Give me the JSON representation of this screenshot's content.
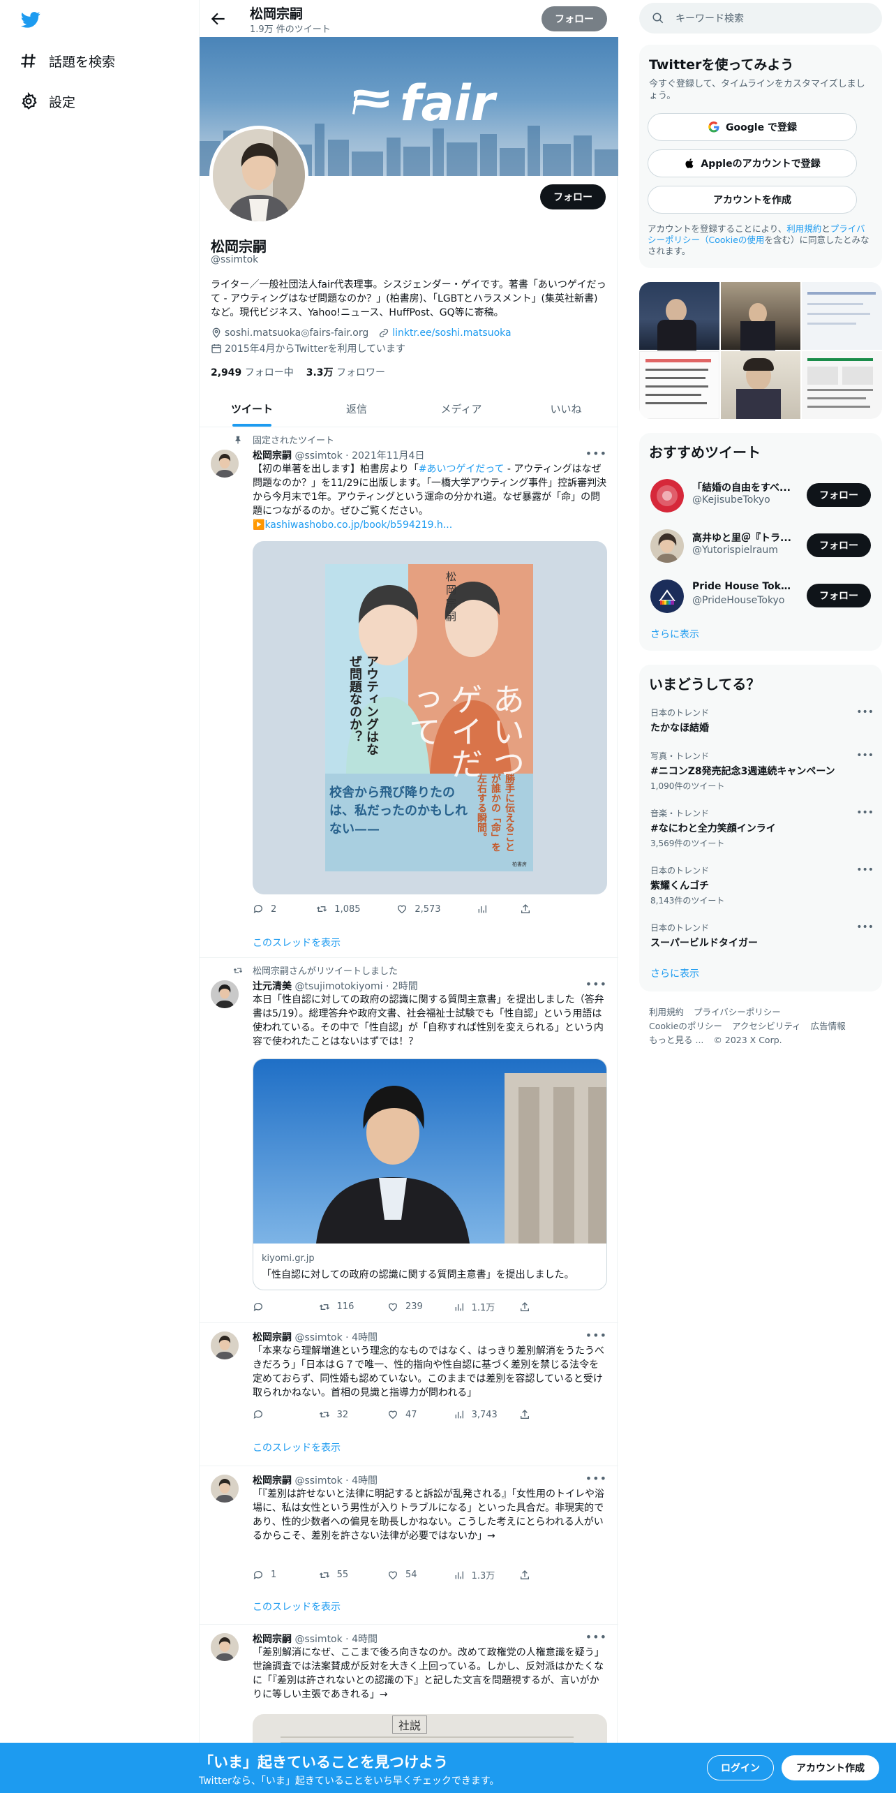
{
  "nav": {
    "items": [
      {
        "label": "話題を検索",
        "icon": "hashtag-icon"
      },
      {
        "label": "設定",
        "icon": "gear-icon"
      }
    ]
  },
  "profile": {
    "header_name": "松岡宗嗣",
    "tweet_count": "1.9万 件のツイート",
    "follow_label": "フォロー",
    "banner_text": "fair",
    "name": "松岡宗嗣",
    "handle": "@ssimtok",
    "bio": "ライター／一般社団法人fair代表理事。シスジェンダー・ゲイです。著書「あいつゲイだって - アウティングはなぜ問題なのか？」(柏書房)、「LGBTとハラスメント」(集英社新書) など。現代ビジネス、Yahoo!ニュース、HuffPost、GQ等に寄稿。",
    "location": "soshi.matsuoka◎fairs-fair.org",
    "website": "linktr.ee/soshi.matsuoka",
    "joined": "2015年4月からTwitterを利用しています",
    "following_count": "2,949",
    "following_label": "フォロー中",
    "followers_count": "3.3万",
    "followers_label": "フォロワー"
  },
  "tabs": [
    "ツイート",
    "返信",
    "メディア",
    "いいね"
  ],
  "tweets": [
    {
      "context": "固定されたツイート",
      "name": "松岡宗嗣",
      "handle": "@ssimtok",
      "time": "2021年11月4日",
      "text_pre": "【初の単著を出します】柏書房より「",
      "text_tag": "#あいつゲイだって",
      "text_post": " - アウティングはなぜ問題なのか？」を11/29に出版します。「一橋大学アウティング事件」控訴審判決から今月末で1年。アウティングという運命の分かれ道。なぜ暴露が「命」の問題につながるのか。ぜひご覧ください。",
      "link": "kashiwashobo.co.jp/book/b594219.h...",
      "book": {
        "author": "松岡宗嗣",
        "title1": "あいつ",
        "title2": "ゲイ",
        "title3": "だって",
        "subtitle": "アウティングはなぜ問題なのか？",
        "side": "勝手に伝えることが誰かの「命」を左右する瞬間。",
        "catch": "校舎から飛び降りたのは、私だったのかもしれない——",
        "publisher": "柏書房"
      },
      "replies": "2",
      "retweets": "1,085",
      "likes": "2,573",
      "thread": "このスレッドを表示"
    },
    {
      "context": "松岡宗嗣さんがリツイートしました",
      "name": "辻元清美",
      "handle": "@tsujimotokiyomi",
      "time": "2時間",
      "text": "本日「性自認に対しての政府の認識に関する質問主意書」を提出しました（答弁書は5/19）。総理答弁や政府文書、社会福祉士試験でも「性自認」という用語は使われている。その中で「性自認」が「自称すれば性別を変えられる」という内容で使われたことはないはずでは！？",
      "card_domain": "kiyomi.gr.jp",
      "card_title": "「性自認に対しての政府の認識に関する質問主意書」を提出しました。",
      "replies": "",
      "retweets": "116",
      "likes": "239",
      "views": "1.1万"
    },
    {
      "name": "松岡宗嗣",
      "handle": "@ssimtok",
      "time": "4時間",
      "text": "「本来なら理解増進という理念的なものではなく、はっきり差別解消をうたうべきだろう」「日本はＧ７で唯一、性的指向や性自認に基づく差別を禁じる法令を定めておらず、同性婚も認めていない。このままでは差別を容認していると受け取られかねない。首相の見識と指導力が問われる」",
      "replies": "",
      "retweets": "32",
      "likes": "47",
      "views": "3,743",
      "thread": "このスレッドを表示"
    },
    {
      "name": "松岡宗嗣",
      "handle": "@ssimtok",
      "time": "4時間",
      "text": "「『差別は許せないと法律に明記すると訴訟が乱発される』「女性用のトイレや浴場に、私は女性という男性が入りトラブルになる」といった具合だ。非現実的であり、性的少数者への偏見を助長しかねない。こうした考えにとらわれる人がいるからこそ、差別を許さない法律が必要ではないか」→",
      "replies": "1",
      "retweets": "55",
      "likes": "54",
      "views": "1.3万",
      "thread": "このスレッドを表示"
    },
    {
      "name": "松岡宗嗣",
      "handle": "@ssimtok",
      "time": "4時間",
      "text": "「差別解消になぜ、ここまで後ろ向きなのか。改めて政権党の人権意識を疑う」世論調査では法案賛成が反対を大きく上回っている。しかし、反対派はかたくなに「『差別は許されないとの認識の下』と記した文言を問題視するが、言いがかりに等しい主張であきれる」→",
      "image_caption": "社説"
    }
  ],
  "right": {
    "search_placeholder": "キーワード検索",
    "signup": {
      "title": "Twitterを使ってみよう",
      "desc": "今すぐ登録して、タイムラインをカスタマイズしましょう。",
      "google": "Google で登録",
      "apple": "Appleのアカウントで登録",
      "create": "アカウントを作成",
      "terms_pre": "アカウントを登録することにより、",
      "terms_link1": "利用規約",
      "terms_mid": "と",
      "terms_link2": "プライバシーポリシー（Cookieの使用",
      "terms_post": "を含む）に同意したとみなされます。"
    },
    "recommend": {
      "title": "おすすめツイート",
      "users": [
        {
          "name": "「結婚の自由をすべ...",
          "handle": "@KejisubeTokyo",
          "follow": "フォロー"
        },
        {
          "name": "高井ゆと里＠『トラ...",
          "handle": "@Yutorispielraum",
          "follow": "フォロー"
        },
        {
          "name": "Pride House Tokyo (...",
          "handle": "@PrideHouseTokyo",
          "follow": "フォロー"
        }
      ],
      "more": "さらに表示"
    },
    "trends": {
      "title": "いまどうしてる？",
      "items": [
        {
          "category": "日本のトレンド",
          "name": "たかなほ結婚",
          "count": ""
        },
        {
          "category": "写真・トレンド",
          "name": "#ニコンZ8発売記念3週連続キャンペーン",
          "count": "1,090件のツイート"
        },
        {
          "category": "音楽・トレンド",
          "name": "#なにわと全力笑顔インライ",
          "count": "3,569件のツイート"
        },
        {
          "category": "日本のトレンド",
          "name": "紫耀くんゴチ",
          "count": "8,143件のツイート"
        },
        {
          "category": "日本のトレンド",
          "name": "スーパービルドタイガー",
          "count": ""
        }
      ],
      "more": "さらに表示"
    },
    "footer": {
      "terms": "利用規約",
      "privacy": "プライバシーポリシー",
      "cookie": "Cookieのポリシー",
      "accessibility": "アクセシビリティ",
      "ads": "広告情報",
      "more": "もっと見る ...",
      "copyright": "© 2023 X Corp."
    }
  },
  "bottom": {
    "headline": "「いま」起きていることを見つけよう",
    "sub": "Twitterなら、「いま」起きていることをいち早くチェックできます。",
    "login": "ログイン",
    "signup": "アカウント作成"
  },
  "colors": {
    "accent": "#1d9bf0",
    "text": "#0f1419",
    "muted": "#536471"
  }
}
